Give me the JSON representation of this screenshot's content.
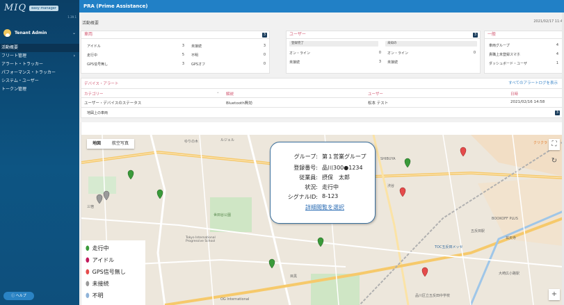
{
  "sidebar": {
    "logo": "MIQ",
    "logo_badge": "easy manager",
    "version": "1.39.1",
    "tenant": "Tenant Admin",
    "items": [
      {
        "label": "活動概要",
        "active": true
      },
      {
        "label": "フリート管理",
        "has_arrow": true
      },
      {
        "label": "アラート・トラッカー"
      },
      {
        "label": "パフォーマンス・トラッカー"
      },
      {
        "label": "システム・ユーザー"
      },
      {
        "label": "トークン管理"
      }
    ],
    "help": "ヘルプ"
  },
  "topbar": {
    "title": "PRA (Prime Assistance)"
  },
  "overview": {
    "title": "活動概要",
    "date": "2021/02/17 11:4"
  },
  "vehicles": {
    "title": "車両",
    "count": "3",
    "rows": [
      {
        "a": "アイドル",
        "av": "3",
        "b": "未接続",
        "bv": "3"
      },
      {
        "a": "走行中",
        "av": "5",
        "b": "不明",
        "bv": "0"
      },
      {
        "a": "GPS信号無し",
        "av": "3",
        "b": "GPSオフ",
        "bv": "0"
      }
    ]
  },
  "users": {
    "title": "ユーザー",
    "count": "3",
    "pills": [
      "登録完了",
      "未知の"
    ],
    "rows": [
      {
        "a": "オン・ライン",
        "av": "0",
        "b": "オン・ライン",
        "bv": "0"
      },
      {
        "a": "未接続",
        "av": "3",
        "b": "未接続",
        "bv": ""
      }
    ]
  },
  "general": {
    "title": "一般",
    "rows": [
      {
        "label": "車両グループ",
        "value": "4"
      },
      {
        "label": "貴職上未登録スマホ",
        "value": "4"
      },
      {
        "label": "ダッシュボード・ユーザ",
        "value": "1"
      }
    ]
  },
  "device_alerts": {
    "title": "デバイス・アラート",
    "all_logs_link": "すべてのアラートログを表示",
    "columns": [
      "カテゴリー",
      "解説",
      "ユーザー",
      "日時"
    ],
    "rows": [
      [
        "ユーザー・デバイスのステータス",
        "Bluetooth無効",
        "松本 テスト",
        "2021/02/16 14:58"
      ]
    ]
  },
  "map": {
    "title": "地図上の車両",
    "count": "3",
    "map_types": [
      "地図",
      "航空写真"
    ],
    "popup": {
      "fields": [
        {
          "label": "グループ:",
          "value": "第１営業グループ"
        },
        {
          "label": "登録番号:",
          "value": "品川300●1234"
        },
        {
          "label": "従業員:",
          "value": "摂保　太郎"
        },
        {
          "label": "状況:",
          "value": "走行中"
        },
        {
          "label": "シグナルID:",
          "value": "8-123"
        }
      ],
      "link": "詳細閲覧を選択"
    },
    "legend": [
      {
        "label": "走行中",
        "color": "#3a9a3a"
      },
      {
        "label": "アイドル",
        "color": "#c2185b"
      },
      {
        "label": "GPS信号無し",
        "color": "#e54b4b"
      },
      {
        "label": "未接続",
        "color": "#999999"
      },
      {
        "label": "不明",
        "color": "#8fb3d9"
      }
    ],
    "place_labels": [
      "ゆりの木",
      "ルジェル",
      "三宿",
      "SHIBUYA",
      "渋谷",
      "目黒",
      "世田谷公園",
      "Tokyo International Progressive School",
      "OG International",
      "大崎広小路駅",
      "品川区立五反田中学校",
      "五反田駅",
      "TOC五反田メッセ",
      "BOOKOFF PLUS",
      "クリクラ",
      "祐天寺"
    ]
  }
}
